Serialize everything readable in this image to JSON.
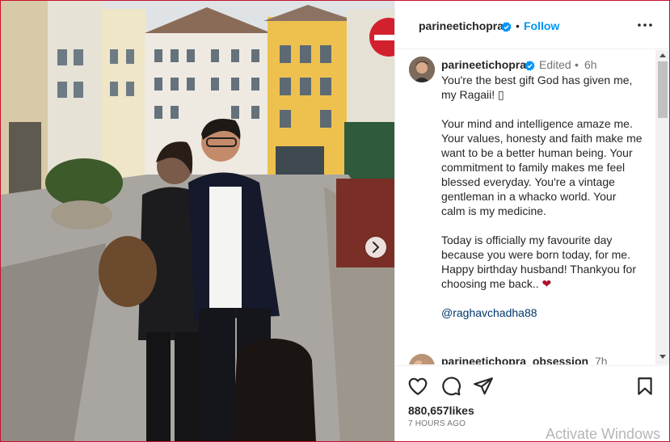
{
  "post": {
    "username": "parineetichopra",
    "follow_label": "Follow",
    "header_dot": "•"
  },
  "caption": {
    "username": "parineetichopra",
    "edited": "Edited",
    "separator": "•",
    "time": "6h",
    "lines": [
      "You're the best gift God has given me,",
      "my Ragaii! ▯",
      "",
      "Your mind and intelligence amaze me.",
      "Your values, honesty and faith make me",
      "want to be a better human being. Your",
      "commitment to family makes me feel",
      "blessed everyday. You're a vintage",
      "gentleman in a whacko world. Your",
      "calm is my medicine.",
      "",
      "Today is officially my favourite day",
      "because you were born today, for me.",
      "Happy birthday husband! Thankyou for",
      "choosing me back.."
    ],
    "emoji": "❤",
    "mention": "@raghavchadha88"
  },
  "comment": {
    "username": "parineetichopra_obsession",
    "time": "7h"
  },
  "stats": {
    "likes": "880,657likes",
    "posted": "7 HOURS AGO"
  },
  "icons": {
    "more": "more-options-icon",
    "like": "heart-icon",
    "comment": "comment-icon",
    "share": "share-icon",
    "save": "bookmark-icon",
    "verified": "verified-badge-icon",
    "next": "chevron-right-icon"
  },
  "colors": {
    "link": "#0095f6",
    "verified": "#0095f6",
    "mention": "#00376b",
    "muted": "#737373"
  },
  "watermark": "Activate Windows"
}
